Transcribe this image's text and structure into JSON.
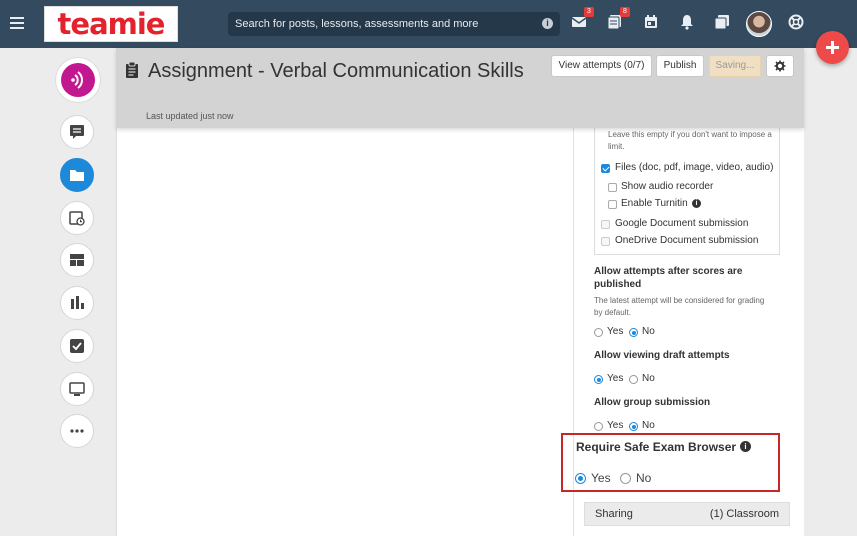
{
  "brand": {
    "logo_text": "teamie",
    "logo_color": "#e3222d"
  },
  "topbar": {
    "search_placeholder": "Search for posts, lessons, assessments and more",
    "messages_badge": "3",
    "tasks_badge": "8"
  },
  "header": {
    "title": "Assignment - Verbal Communication Skills",
    "subtitle": "Last updated just now",
    "view_attempts": "View attempts (0/7)",
    "publish": "Publish",
    "saving": "Saving..."
  },
  "settings": {
    "limit_note": "Leave this empty if you don't want to impose a limit.",
    "files_label": "Files (doc, pdf, image, video, audio)",
    "show_audio_recorder": "Show audio recorder",
    "enable_turnitin": "Enable Turnitin",
    "google_doc": "Google Document submission",
    "onedrive_doc": "OneDrive Document submission",
    "allow_attempts_title": "Allow attempts after scores are published",
    "allow_attempts_note": "The latest attempt will be considered for grading by default.",
    "allow_viewing_title": "Allow viewing draft attempts",
    "allow_group_title": "Allow group submission",
    "yes": "Yes",
    "no": "No",
    "seb_title": "Require Safe Exam Browser",
    "sharing_label": "Sharing",
    "sharing_value": "(1) Classroom"
  },
  "colors": {
    "topbar": "#344a5e",
    "accent": "#1e88d9",
    "fab": "#ef4a4a",
    "highlight": "#c62828"
  }
}
